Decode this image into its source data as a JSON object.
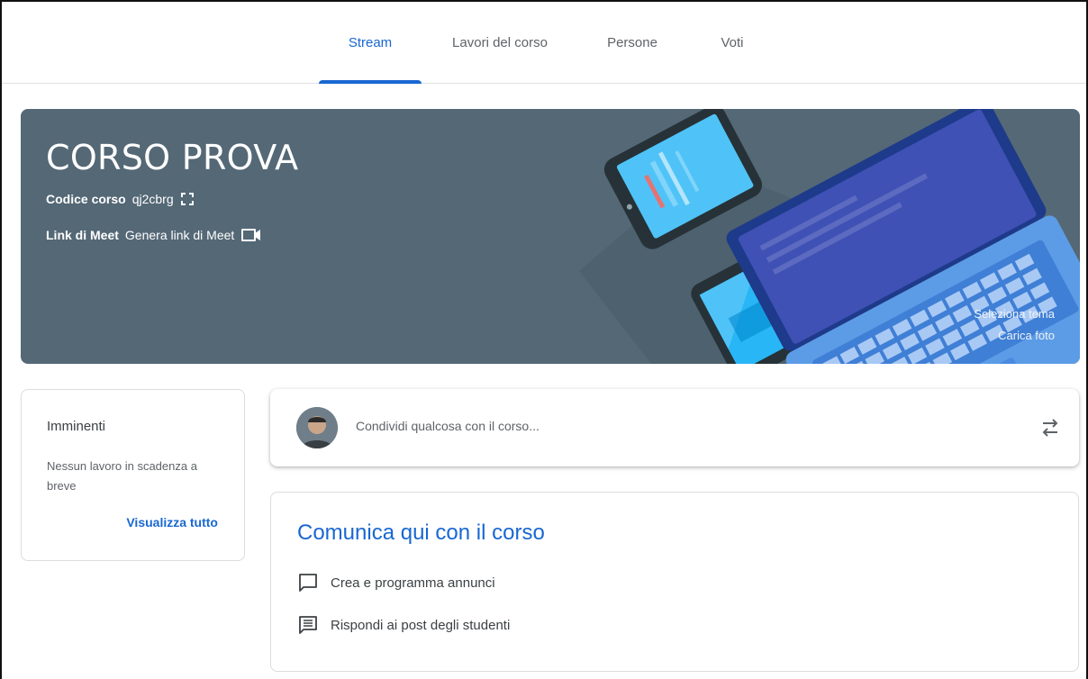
{
  "nav": {
    "tabs": [
      {
        "label": "Stream",
        "active": true
      },
      {
        "label": "Lavori del corso",
        "active": false
      },
      {
        "label": "Persone",
        "active": false
      },
      {
        "label": "Voti",
        "active": false
      }
    ]
  },
  "banner": {
    "title": "CORSO PROVA",
    "code_label": "Codice corso",
    "code_value": "qj2cbrg",
    "meet_label": "Link di Meet",
    "meet_value": "Genera link di Meet",
    "select_theme": "Seleziona tema",
    "upload_photo": "Carica foto",
    "bg_color": "#546876"
  },
  "upcoming": {
    "title": "Imminenti",
    "body": "Nessun lavoro in scadenza a breve",
    "view_all": "Visualizza tutto"
  },
  "share": {
    "placeholder": "Condividi qualcosa con il corso..."
  },
  "communicate": {
    "heading": "Comunica qui con il corso",
    "items": [
      {
        "label": "Crea e programma annunci",
        "icon": "chat-bubble-icon"
      },
      {
        "label": "Rispondi ai post degli studenti",
        "icon": "message-text-icon"
      }
    ]
  },
  "colors": {
    "accent": "#1967d2",
    "text": "#3c4043",
    "muted": "#5f6368"
  }
}
